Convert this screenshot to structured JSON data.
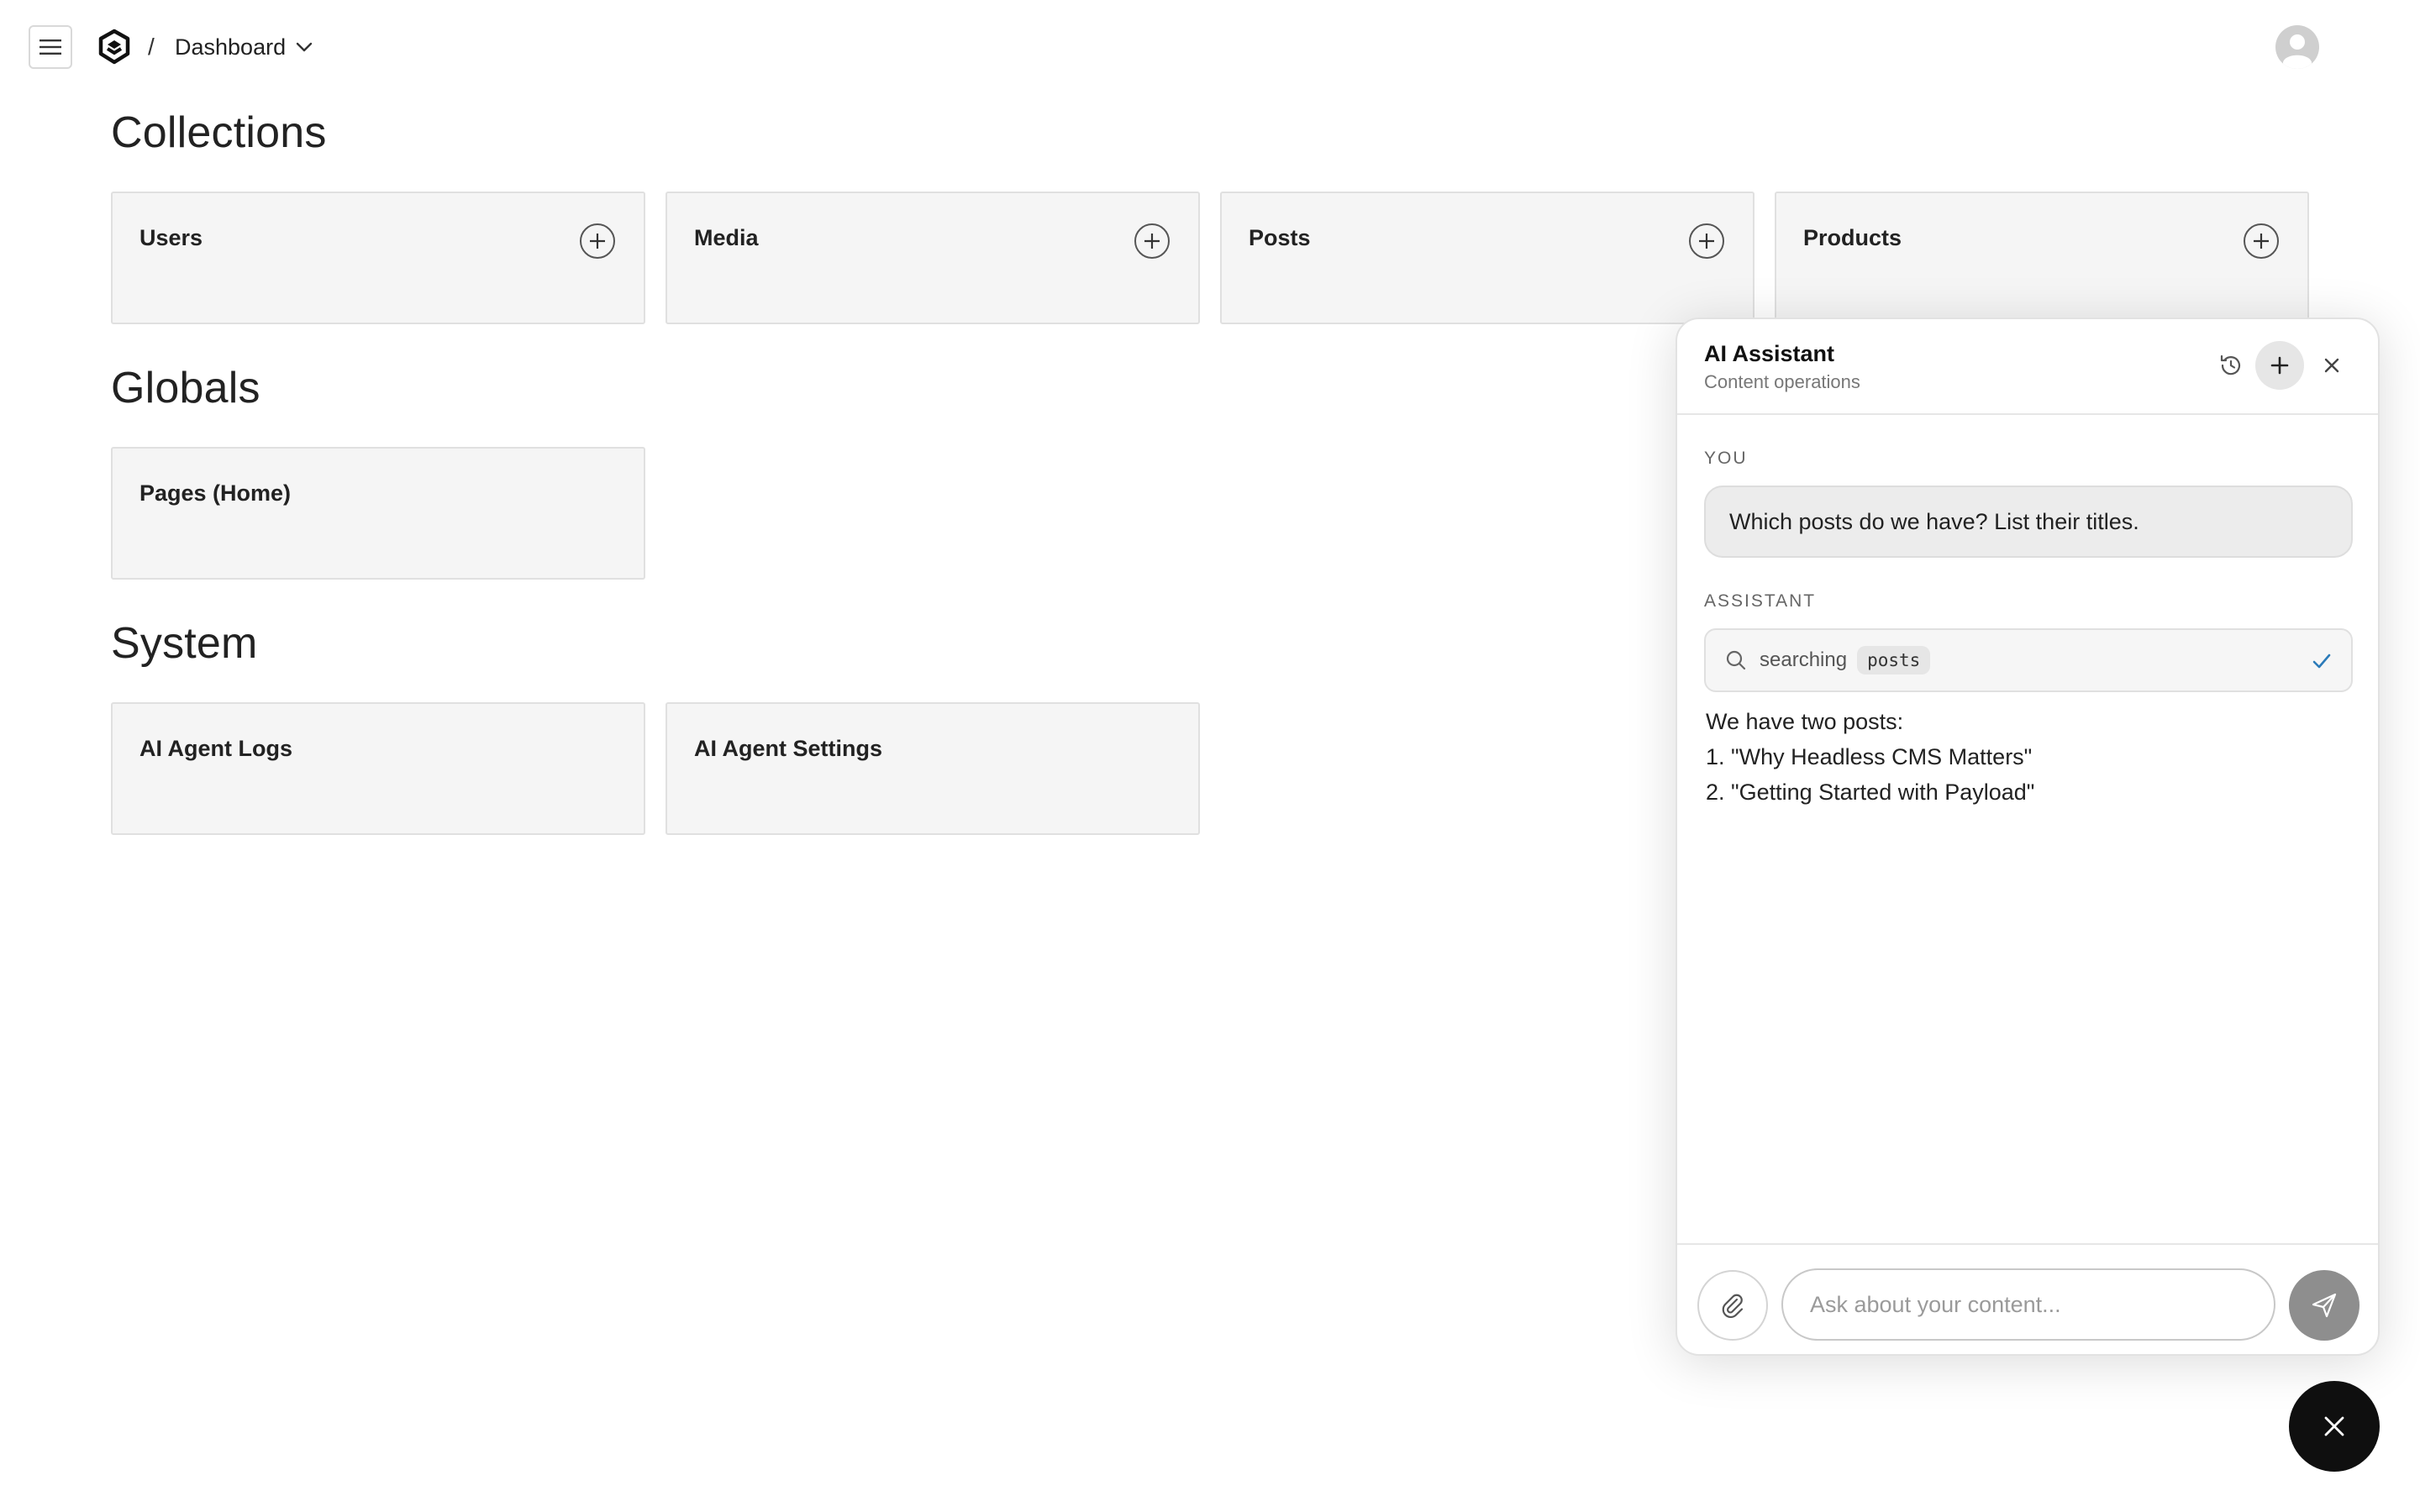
{
  "header": {
    "menu_icon": "hamburger-icon",
    "logo_icon": "payload-logo-icon",
    "breadcrumb_separator": "/",
    "breadcrumb_current": "Dashboard",
    "breadcrumb_dropdown_icon": "chevron-down-icon",
    "avatar_icon": "user-avatar-icon"
  },
  "sections": {
    "collections": {
      "title": "Collections",
      "cards": [
        {
          "label": "Users"
        },
        {
          "label": "Media"
        },
        {
          "label": "Posts"
        },
        {
          "label": "Products"
        }
      ]
    },
    "globals": {
      "title": "Globals",
      "cards": [
        {
          "label": "Pages (Home)"
        }
      ]
    },
    "system": {
      "title": "System",
      "cards": [
        {
          "label": "AI Agent Logs"
        },
        {
          "label": "AI Agent Settings"
        }
      ]
    }
  },
  "assistant": {
    "title": "AI Assistant",
    "subtitle": "Content operations",
    "header_icons": [
      "history-icon",
      "plus-icon",
      "close-icon"
    ],
    "user_role": "YOU",
    "user_message": "Which posts do we have? List their titles.",
    "assistant_role": "ASSISTANT",
    "tool": {
      "icon": "search-icon",
      "text": "searching",
      "chip": "posts",
      "status_icon": "check-icon"
    },
    "answer_lines": [
      "We have two posts:",
      "1. \"Why Headless CMS Matters\"",
      "2. \"Getting Started with Payload\""
    ],
    "input_placeholder": "Ask about your content...",
    "attach_icon": "paperclip-icon",
    "send_icon": "send-icon"
  },
  "fab": {
    "icon": "close-icon"
  },
  "colors": {
    "card_bg": "#f5f5f5",
    "card_border": "#e0e0e0",
    "bubble_bg": "#ececec",
    "check": "#2b7bb9",
    "send_bg": "#8e8e8e",
    "fab_bg": "#0f0f0f"
  }
}
